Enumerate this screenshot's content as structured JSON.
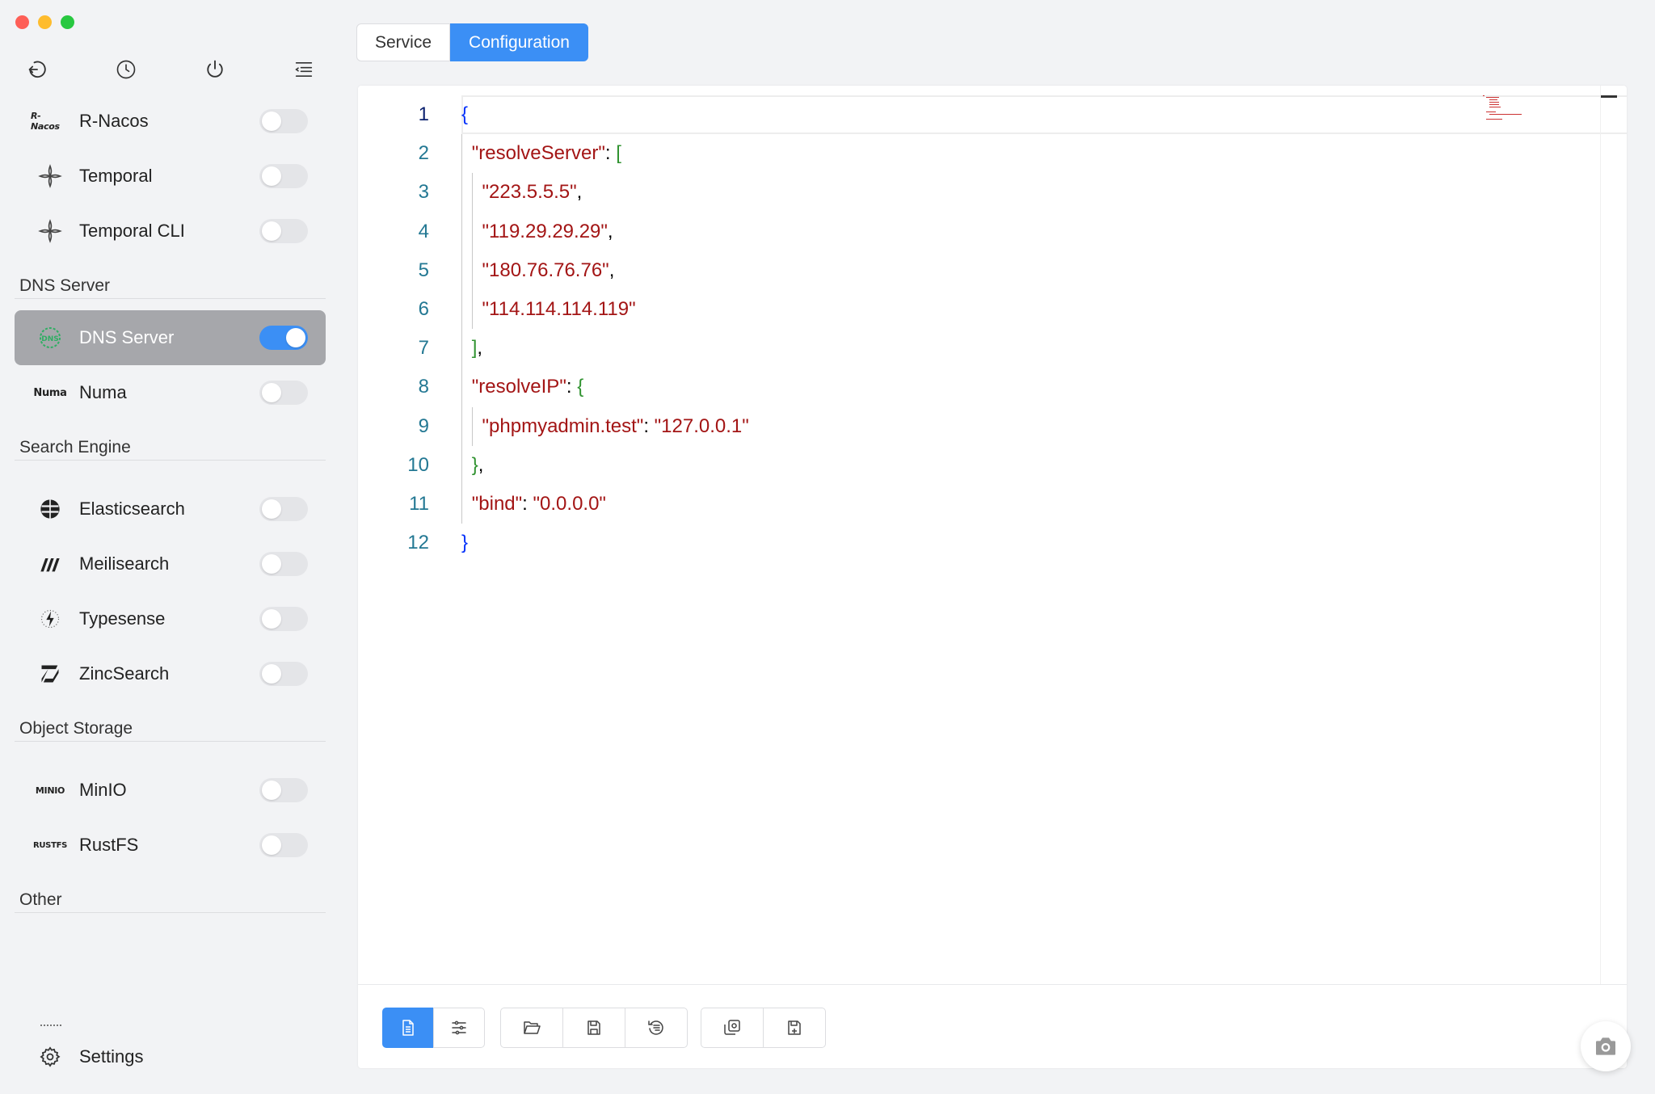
{
  "sidebar": {
    "toolbar": [
      {
        "icon": "back-icon"
      },
      {
        "icon": "history-icon"
      },
      {
        "icon": "power-icon"
      },
      {
        "icon": "menu-collapse-icon"
      }
    ],
    "items_top": [
      {
        "label": "R-Nacos",
        "logo_text": "R-Nacos",
        "enabled": false
      },
      {
        "label": "Temporal",
        "logo": "temporal-icon",
        "enabled": false
      },
      {
        "label": "Temporal CLI",
        "logo": "temporal-icon",
        "enabled": false
      }
    ],
    "sections": {
      "dns": "DNS Server",
      "search": "Search Engine",
      "storage": "Object Storage",
      "other": "Other"
    },
    "dns_items": [
      {
        "label": "DNS Server",
        "logo_text": "DNS",
        "enabled": true,
        "active": true
      },
      {
        "label": "Numa",
        "logo_text": "Numa",
        "enabled": false
      }
    ],
    "search_items": [
      {
        "label": "Elasticsearch",
        "logo": "elasticsearch-icon",
        "enabled": false
      },
      {
        "label": "Meilisearch",
        "logo": "meilisearch-icon",
        "enabled": false
      },
      {
        "label": "Typesense",
        "logo": "typesense-icon",
        "enabled": false
      },
      {
        "label": "ZincSearch",
        "logo": "zincsearch-icon",
        "enabled": false
      }
    ],
    "storage_items": [
      {
        "label": "MinIO",
        "logo_text": "MINIO",
        "enabled": false
      },
      {
        "label": "RustFS",
        "logo_text": "RUSTFS",
        "enabled": false
      }
    ],
    "settings_label": "Settings"
  },
  "tabs": [
    {
      "label": "Service",
      "active": false
    },
    {
      "label": "Configuration",
      "active": true
    }
  ],
  "editor": {
    "current_line": 1,
    "line_numbers": [
      "1",
      "2",
      "3",
      "4",
      "5",
      "6",
      "7",
      "8",
      "9",
      "10",
      "11",
      "12"
    ],
    "lines": [
      "{",
      "  \"resolveServer\": [",
      "    \"223.5.5.5\",",
      "    \"119.29.29.29\",",
      "    \"180.76.76.76\",",
      "    \"114.114.114.119\"",
      "  ],",
      "  \"resolveIP\": {",
      "    \"phpmyadmin.test\": \"127.0.0.1\"",
      "  },",
      "  \"bind\": \"0.0.0.0\"",
      "}"
    ]
  },
  "footer_buttons": [
    {
      "icon": "document-icon",
      "active": true
    },
    {
      "icon": "sliders-icon",
      "active": false
    },
    {
      "icon": "folder-open-icon",
      "active": false
    },
    {
      "icon": "save-icon",
      "active": false
    },
    {
      "icon": "format-icon",
      "active": false
    },
    {
      "icon": "copy-settings-icon",
      "active": false
    },
    {
      "icon": "save-as-icon",
      "active": false
    }
  ],
  "colors": {
    "accent": "#3b8ff5",
    "string": "#a31515",
    "bracket1": "#0431fa",
    "bracket2": "#319331",
    "line_number": "#237893"
  }
}
